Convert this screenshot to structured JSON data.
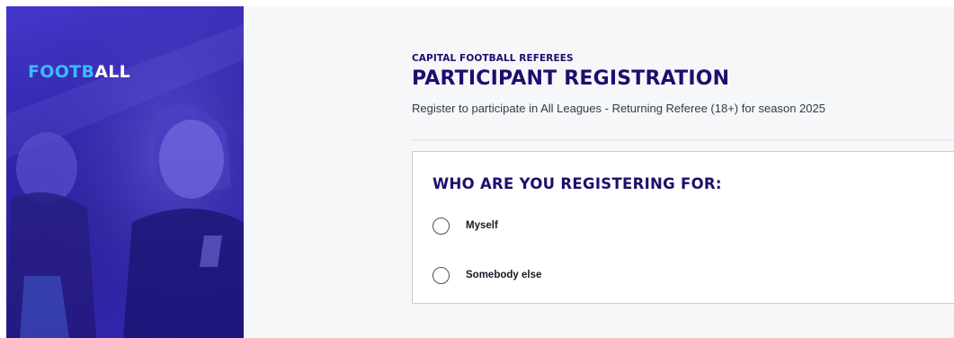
{
  "hero": {
    "logo_accent": "FOOTB",
    "logo_rest": "ALL",
    "image": "children-football-players-photo"
  },
  "header": {
    "org_name": "CAPITAL FOOTBALL REFEREES",
    "title": "PARTICIPANT REGISTRATION",
    "subtitle": "Register to participate in All Leagues - Returning Referee (18+) for season 2025"
  },
  "form": {
    "question": "WHO ARE YOU REGISTERING FOR:",
    "options": [
      {
        "label": "Myself",
        "selected": false
      },
      {
        "label": "Somebody else",
        "selected": false
      }
    ]
  },
  "colors": {
    "brand_navy": "#1c0f6e",
    "hero_purple": "#2c1fa6",
    "logo_accent": "#3fb8ff"
  }
}
